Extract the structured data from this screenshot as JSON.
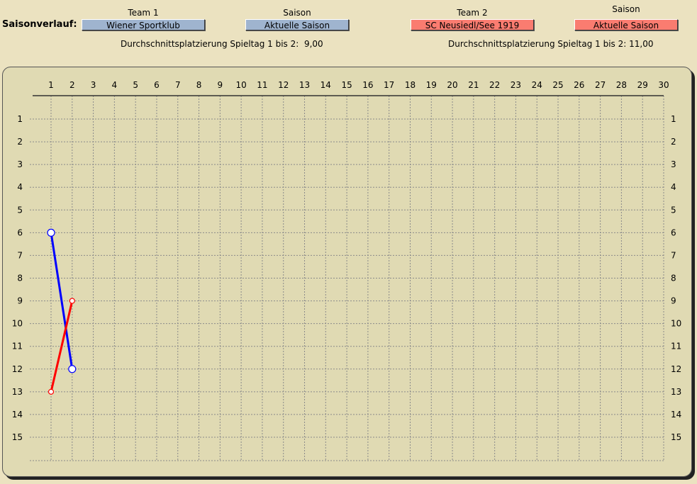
{
  "header": {
    "label": "Saisonverlauf:",
    "team1_heading": "Team 1",
    "season1_heading": "Saison",
    "team2_heading": "Team 2",
    "season2_heading": "Saison",
    "team1_value": "Wiener Sportklub",
    "season1_value": "Aktuelle Saison",
    "team2_value": "SC Neusiedl/See 1919",
    "season2_value": "Aktuelle Saison",
    "avg1_label": "Durchschnittsplatzierung Spieltag 1 bis 2:",
    "avg1_value": "9,00",
    "avg2_label": "Durchschnittsplatzierung Spieltag 1 bis 2:",
    "avg2_value": "11,00"
  },
  "colors": {
    "team1": "#9fb4cf",
    "team2": "#fa7c70",
    "line1": "#0000ff",
    "line2": "#ff0000",
    "panel": "#e0dab3",
    "background": "#ebe2c0"
  },
  "chart_data": {
    "type": "line",
    "x_ticks": [
      1,
      2,
      3,
      4,
      5,
      6,
      7,
      8,
      9,
      10,
      11,
      12,
      13,
      14,
      15,
      16,
      17,
      18,
      19,
      20,
      21,
      22,
      23,
      24,
      25,
      26,
      27,
      28,
      29,
      30
    ],
    "y_ticks": [
      1,
      2,
      3,
      4,
      5,
      6,
      7,
      8,
      9,
      10,
      11,
      12,
      13,
      14,
      15
    ],
    "xlim": [
      1,
      30
    ],
    "ylim": [
      1,
      15
    ],
    "y_inverted": true,
    "grid": true,
    "series": [
      {
        "name": "Wiener Sportklub",
        "x": [
          1,
          2
        ],
        "y": [
          6,
          12
        ],
        "color": "#0000ff"
      },
      {
        "name": "SC Neusiedl/See 1919",
        "x": [
          1,
          2
        ],
        "y": [
          13,
          9
        ],
        "color": "#ff0000"
      }
    ]
  }
}
